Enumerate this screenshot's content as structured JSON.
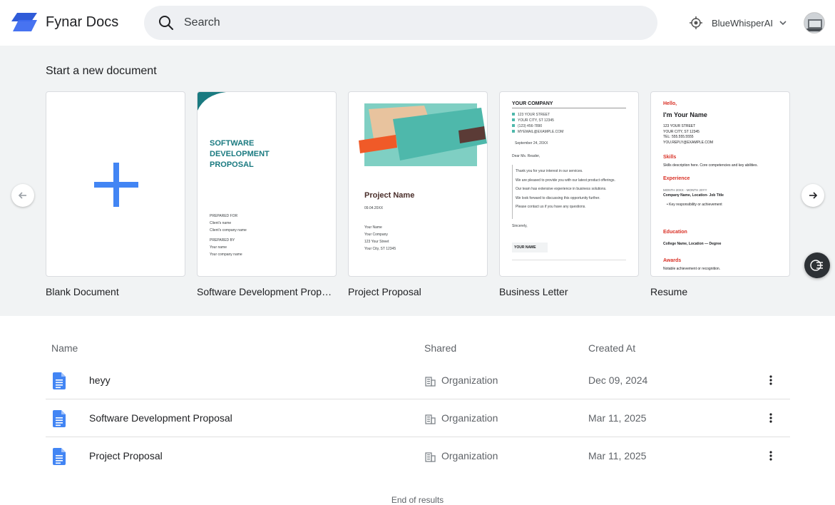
{
  "app": {
    "name": "Fynar Docs"
  },
  "search": {
    "placeholder": "Search"
  },
  "org": {
    "name": "BlueWhisperAI"
  },
  "templates": {
    "title": "Start a new document",
    "items": [
      {
        "label": "Blank Document"
      },
      {
        "label": "Software Development Proposal"
      },
      {
        "label": "Project Proposal"
      },
      {
        "label": "Business Letter"
      },
      {
        "label": "Resume"
      }
    ],
    "software": {
      "heading": [
        "SOFTWARE",
        "DEVELOPMENT",
        "PROPOSAL"
      ],
      "prepared_for": "PREPARED FOR",
      "client_name": "Client's name",
      "client_company": "Client's company name",
      "prepared_by": "PREPARED BY",
      "your_name": "Your name",
      "your_company": "Your company name"
    },
    "project": {
      "title": "Project Name",
      "date": "09.04.20XX",
      "lines": [
        "Your Name",
        "Your Company",
        "123 Your Street",
        "Your City, ST 12345"
      ]
    },
    "letter": {
      "company": "YOUR COMPANY",
      "address": [
        "123 YOUR STREET",
        "YOUR CITY, ST 12345",
        "(123) 456-7890",
        "MYEMAIL@EXAMPLE.COM"
      ],
      "date": "September 24, 20XX",
      "greeting": "Dear Ms. Reader,",
      "body": [
        "Thank you for your interest in our services.",
        "We are pleased to provide you with our latest product offerings.",
        "Our team has extensive experience in business solutions.",
        "We look forward to discussing this opportunity further.",
        "Please contact us if you have any questions."
      ],
      "closing": "Sincerely,",
      "sign": "YOUR NAME"
    },
    "resume": {
      "hello": "Hello,",
      "name": "I'm Your Name",
      "address": [
        "123 YOUR STREET",
        "YOUR CITY, ST 12345",
        "TEL: 555.555.5555",
        "YOU.REPLY@EXAMPLE.COM"
      ],
      "skills_h": "Skills",
      "skills": "Skills description here. Core competencies and key abilities.",
      "exp_h": "Experience",
      "exp_dates": "MONTH 20XX - MONTH 20YY",
      "exp_role": "Company Name, Location- Job Title",
      "exp_bullet": "Key responsibility or achievement",
      "edu_h": "Education",
      "edu": "College Name, Location — Degree",
      "awards_h": "Awards",
      "awards": "Notable achievement or recognition."
    }
  },
  "table": {
    "headers": {
      "name": "Name",
      "shared": "Shared",
      "created": "Created At"
    },
    "rows": [
      {
        "name": "heyy",
        "shared": "Organization",
        "created": "Dec 09, 2024"
      },
      {
        "name": "Software Development Proposal",
        "shared": "Organization",
        "created": "Mar 11, 2025"
      },
      {
        "name": "Project Proposal",
        "shared": "Organization",
        "created": "Mar 11, 2025"
      }
    ],
    "end_text": "End of results"
  },
  "colors": {
    "brand": "#3461e8",
    "doc_blue": "#4285f4",
    "teal": "#1a7a80",
    "red": "#d93025"
  }
}
